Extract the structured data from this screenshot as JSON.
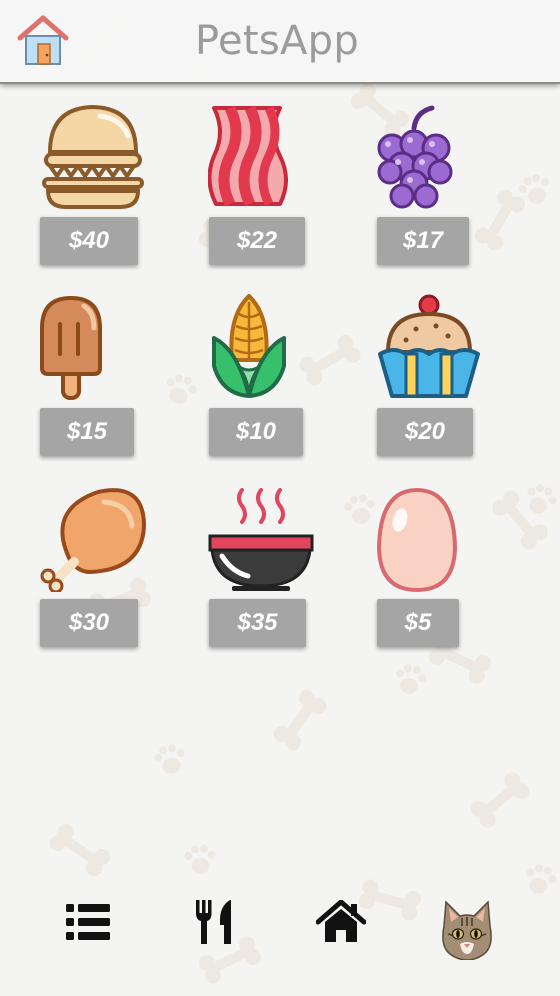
{
  "app": {
    "title": "PetsApp"
  },
  "foods": [
    {
      "name": "burger-icon",
      "price": "$40"
    },
    {
      "name": "bacon-icon",
      "price": "$22"
    },
    {
      "name": "grapes-icon",
      "price": "$17"
    },
    {
      "name": "popsicle-icon",
      "price": "$15"
    },
    {
      "name": "corn-icon",
      "price": "$10"
    },
    {
      "name": "cupcake-icon",
      "price": "$20"
    },
    {
      "name": "drumstick-icon",
      "price": "$30"
    },
    {
      "name": "soup-bowl-icon",
      "price": "$35"
    },
    {
      "name": "egg-icon",
      "price": "$5"
    }
  ],
  "nav": [
    "list-icon",
    "fork-knife-icon",
    "home-icon",
    "cat-avatar-icon"
  ],
  "colors": {
    "price_bg": "#a5a5a5",
    "title": "#9b9b9b",
    "header_bg": "#f6f6f6",
    "background": "#f4f4f3"
  }
}
